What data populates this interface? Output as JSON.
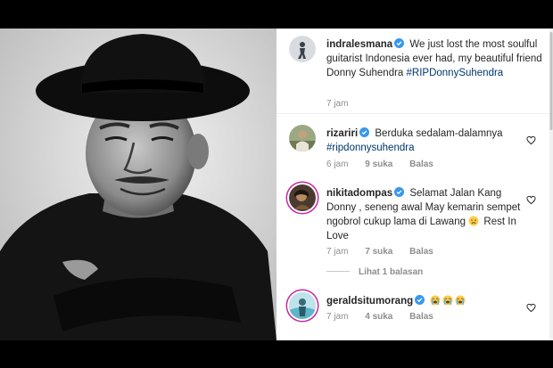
{
  "post": {
    "username": "indralesmana",
    "text": "We just lost the most soulful guitarist Indonesia ever had, my beautiful friend Donny Suhendra",
    "hashtag": "#RIPDonnySuhendra",
    "time": "7 jam"
  },
  "comments": [
    {
      "username": "rizariri",
      "text": "Berduka sedalam-dalamnya",
      "hashtag": "#ripdonnysuhendra",
      "time": "6 jam",
      "likes": "9 suka",
      "reply_label": "Balas"
    },
    {
      "username": "nikitadompas",
      "text": "Selamat Jalan Kang Donny , seneng awal May kemarin sempet ngobrol cukup lama di Lawang",
      "text_end": "Rest In Love",
      "time": "7 jam",
      "likes": "7 suka",
      "reply_label": "Balas",
      "view_replies": "Lihat 1 balasan"
    },
    {
      "username": "geraldsitumorang",
      "time": "7 jam",
      "likes": "4 suka",
      "reply_label": "Balas"
    }
  ],
  "icons": {
    "verified": "verified-badge-icon",
    "heart": "heart-outline-icon",
    "sad_emoji": "sad-face-emoji",
    "crying_emoji": "loudly-crying-face-emoji"
  },
  "colors": {
    "verified_blue": "#3897f0",
    "hashtag": "#00376b",
    "meta_gray": "#8e8e8e",
    "story_ring": "#c32aa3"
  }
}
